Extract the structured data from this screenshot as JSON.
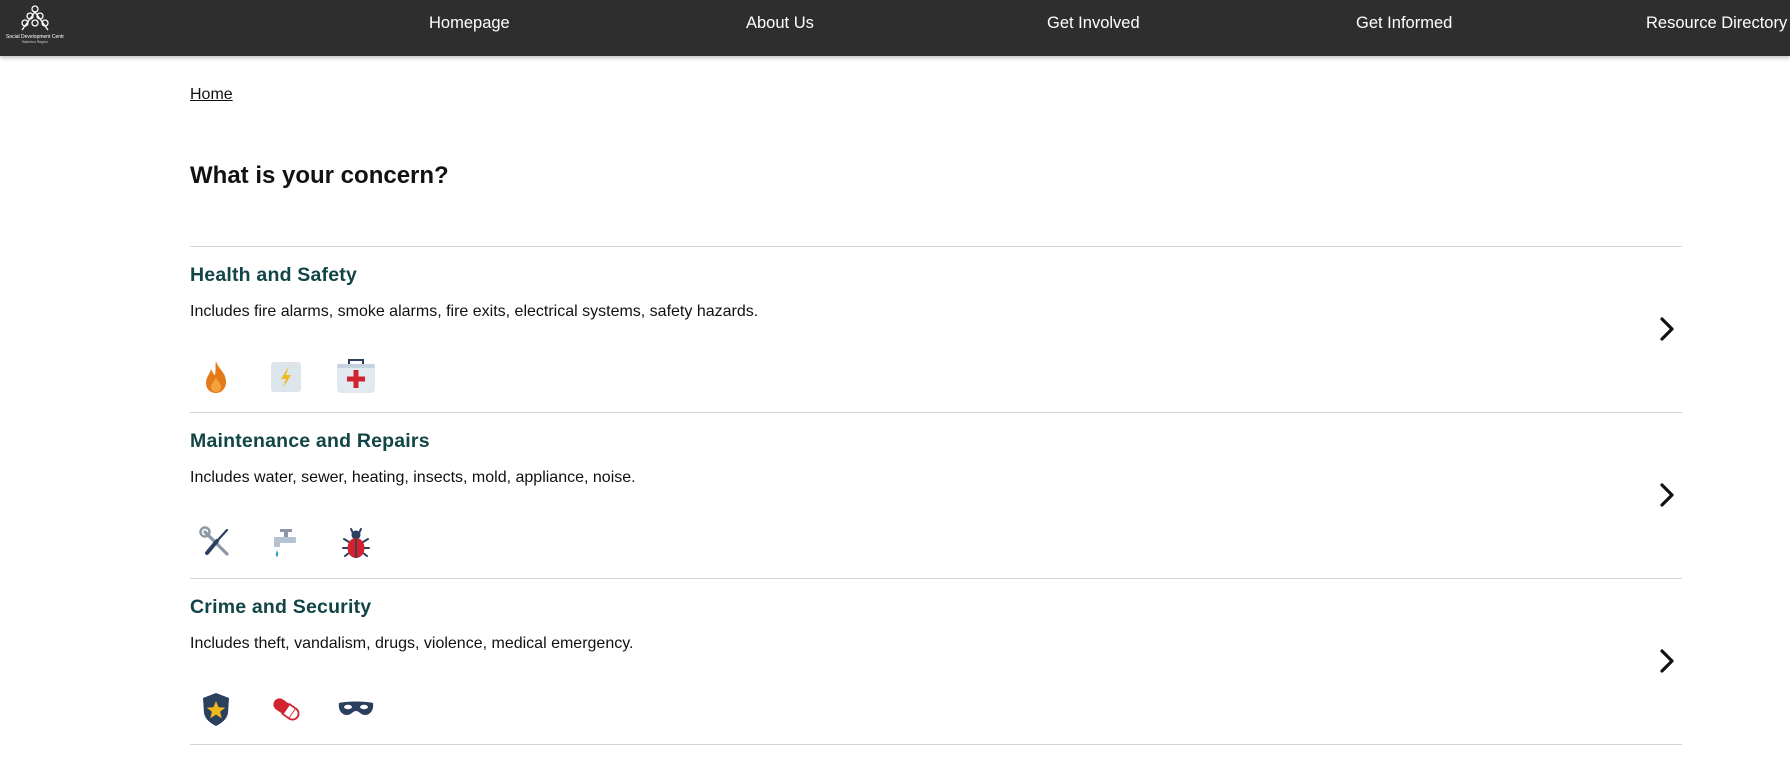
{
  "navbar": {
    "logo_text": "Social Development Centre",
    "logo_subtext": "Waterloo Region",
    "links": [
      {
        "label": "Homepage"
      },
      {
        "label": "About Us"
      },
      {
        "label": "Get Involved"
      },
      {
        "label": "Get Informed"
      },
      {
        "label": "Resource Directory"
      }
    ]
  },
  "breadcrumb": {
    "home": "Home"
  },
  "page": {
    "title": "What is your concern?"
  },
  "concerns": [
    {
      "title": "Health and Safety",
      "description": "Includes fire alarms, smoke alarms, fire exits, electrical systems, safety hazards.",
      "icons": [
        "fire-icon",
        "electrical-icon",
        "first-aid-kit-icon"
      ]
    },
    {
      "title": "Maintenance and Repairs",
      "description": "Includes water, sewer, heating, insects, mold, appliance, noise.",
      "icons": [
        "tools-icon",
        "faucet-icon",
        "bug-icon"
      ]
    },
    {
      "title": "Crime and Security",
      "description": "Includes theft, vandalism, drugs, violence, medical emergency.",
      "icons": [
        "police-badge-icon",
        "pill-icon",
        "mask-icon"
      ]
    }
  ],
  "colors": {
    "navbar_bg": "#2e2e2e",
    "heading_accent": "#124545",
    "divider": "#d4d4d4"
  }
}
